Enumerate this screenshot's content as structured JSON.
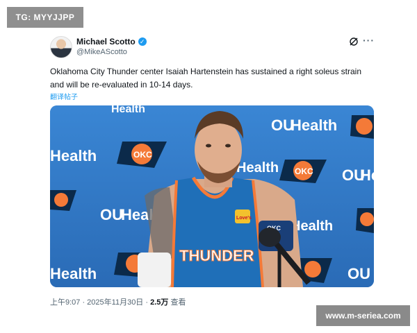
{
  "watermarks": {
    "top_left": "TG: MYYJJPP",
    "bottom_right": "www.m-seriea.com"
  },
  "post": {
    "author_name": "Michael Scotto",
    "handle": "@MikeAScotto",
    "text": "Oklahoma City Thunder center Isaiah Hartenstein has sustained a right soleus strain and will be re-evaluated in 10-14 days.",
    "translate_label": "翻译帖子",
    "time": "上午9:07 · 2025年11月30日 · ",
    "views_count": "2.5万",
    "views_label": " 查看",
    "icons": [
      "verified-badge-icon",
      "grok-icon",
      "more-icon"
    ]
  },
  "media": {
    "backdrop_texts": {
      "health": "Health",
      "ou": "OU",
      "okc": "OKC"
    },
    "jersey_text": "THUNDER",
    "jersey_patch": "Love's",
    "mic_text": "OKC",
    "colors": {
      "backdrop": "#2f77c6",
      "jersey": "#1f6fb8",
      "trim": "#f47a38",
      "okc_navy": "#0b2a4a"
    }
  }
}
